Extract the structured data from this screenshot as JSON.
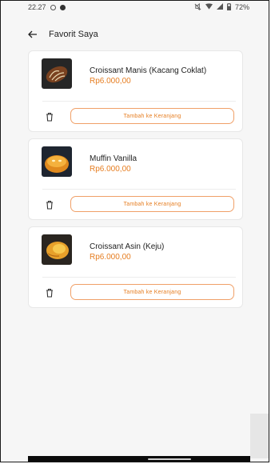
{
  "status": {
    "time": "22.27",
    "battery": "72%"
  },
  "header": {
    "title": "Favorit Saya"
  },
  "items": [
    {
      "name": "Croissant Manis (Kacang Coklat)",
      "price": "Rp6.000,00",
      "button": "Tambah ke Keranjang"
    },
    {
      "name": "Muffin Vanilla",
      "price": "Rp6.000,00",
      "button": "Tambah ke Keranjang"
    },
    {
      "name": "Croissant Asin (Keju)",
      "price": "Rp6.000,00",
      "button": "Tambah ke Keranjang"
    }
  ],
  "colors": {
    "accent": "#e67e22",
    "accent_border": "#f0a068",
    "background": "#f6f6f6"
  },
  "icons": {
    "back": "back-arrow-icon",
    "delete": "trash-icon"
  }
}
